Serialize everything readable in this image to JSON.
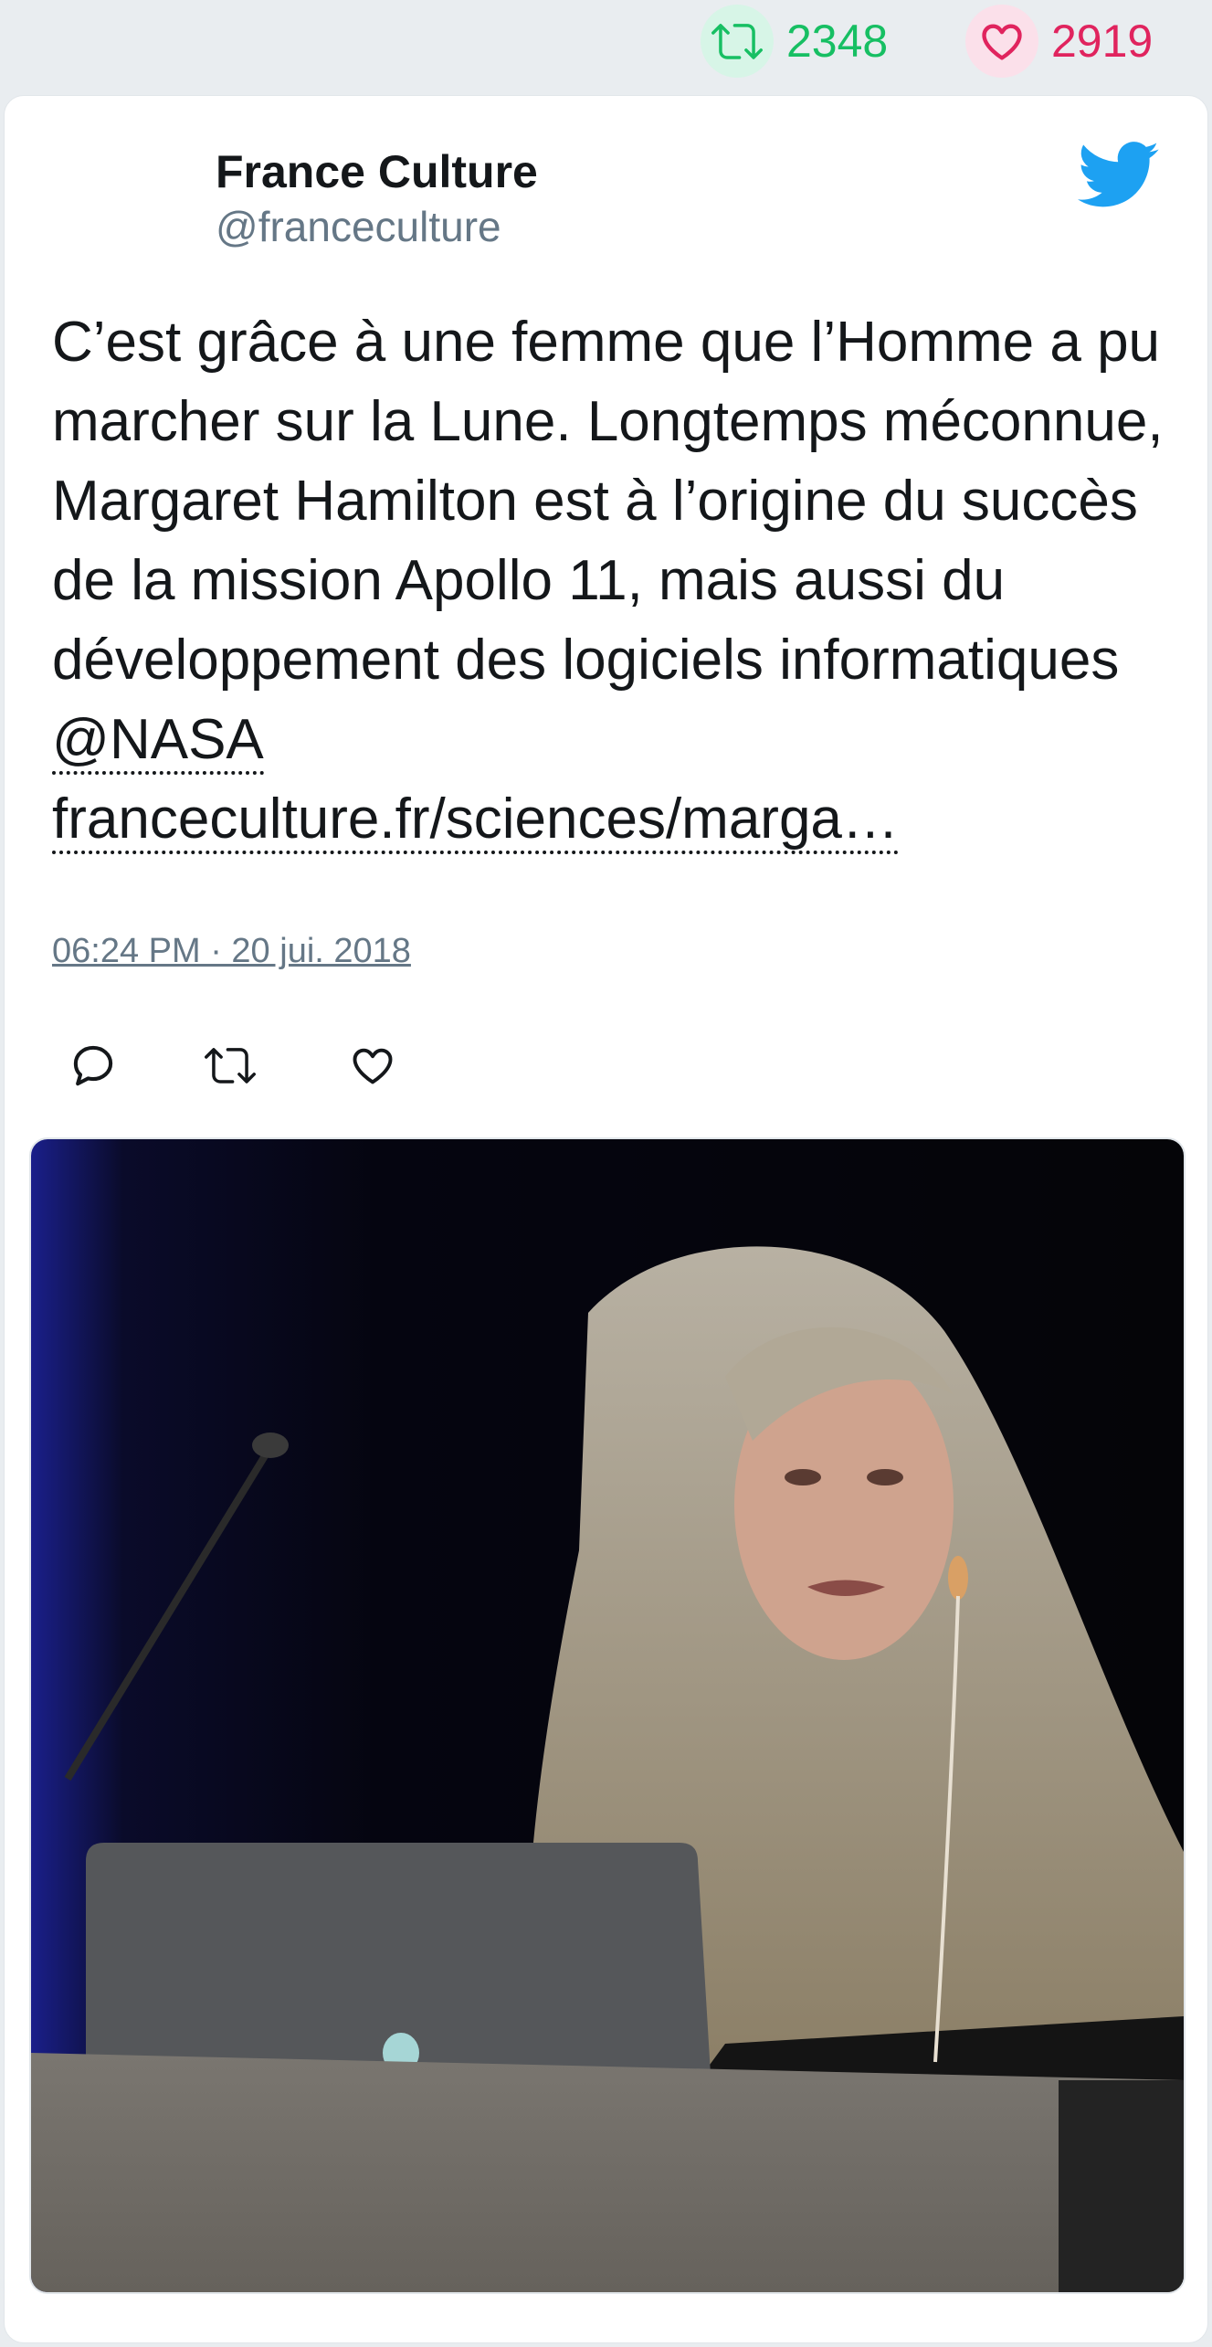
{
  "stats": {
    "retweets": "2348",
    "likes": "2919"
  },
  "author": {
    "name": "France Culture",
    "handle": "@franceculture"
  },
  "tweet": {
    "text": "C’est grâce à une femme que l’Homme a pu marcher sur la Lune. Longtemps méconnue, Margaret Hamilton est à l’origine du succès de la mission Apollo 11, mais aussi du développement des logiciels informatiques ",
    "mention": "@NASA",
    "link": "franceculture.fr/sciences/marga…",
    "timestamp": "06:24 PM · 20 jui. 2018"
  },
  "icons": {
    "brand": "twitter-bird-icon",
    "reply": "reply-icon",
    "retweet": "retweet-icon",
    "like": "heart-icon"
  },
  "colors": {
    "brand_blue": "#1da1f2",
    "retweet_green": "#17bf63",
    "like_pink": "#e0245e",
    "secondary_text": "#657786"
  }
}
